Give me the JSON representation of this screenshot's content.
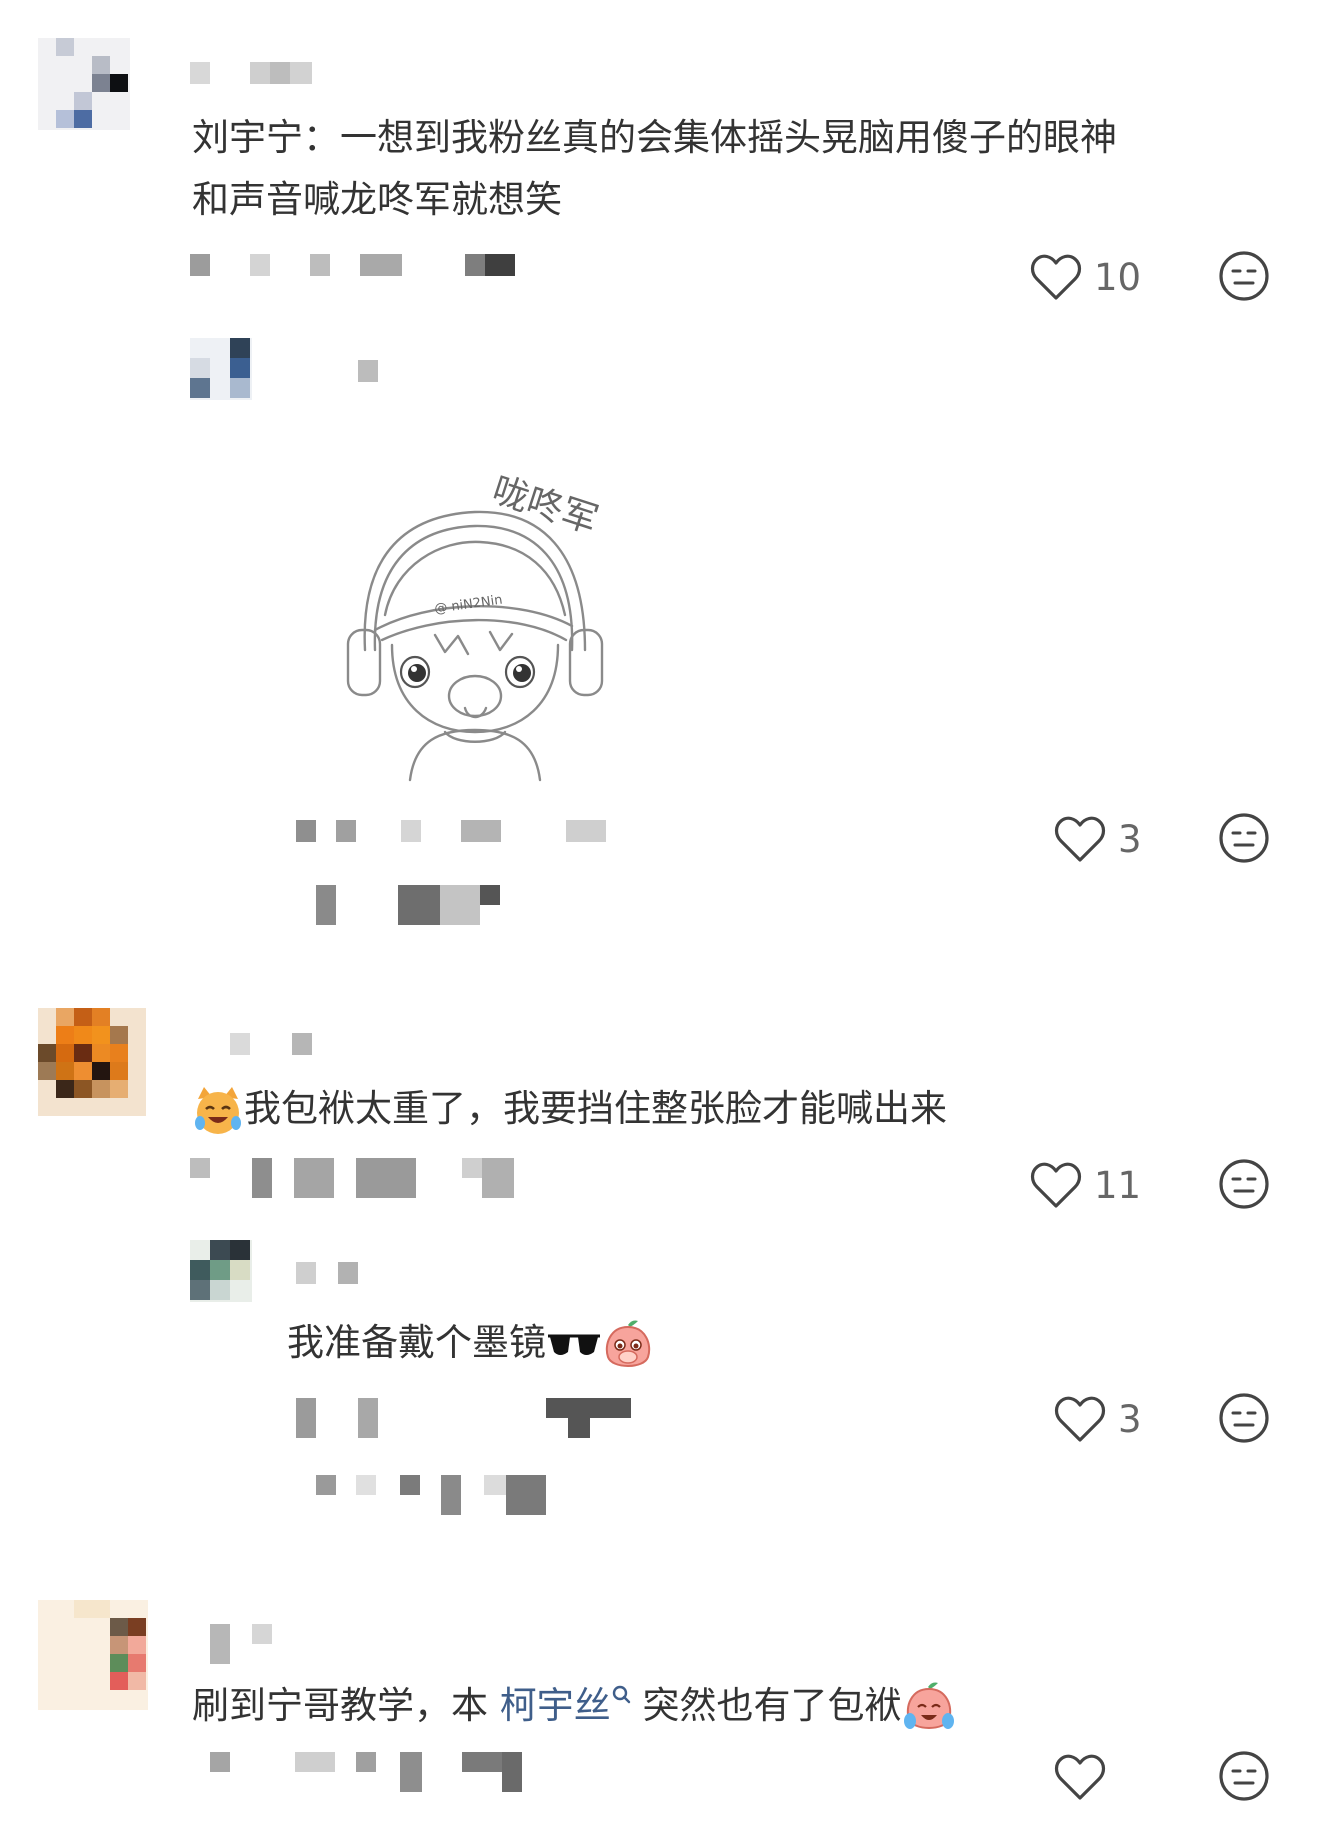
{
  "comments": [
    {
      "text_line1": "刘宇宁：一想到我粉丝真的会集体摇头晃脑用傻子的眼神",
      "text_line2": "和声音喊龙咚军就想笑",
      "likes": "10"
    },
    {
      "reply_image_caption": "咙咚军",
      "reply_image_watermark": "@ niN2Nin",
      "likes": "3"
    },
    {
      "text": "我包袱太重了，我要挡住整张脸才能喊出来",
      "likes": "11"
    },
    {
      "text": "我准备戴个墨镜",
      "likes": "3"
    },
    {
      "text_before_link": "刷到宁哥教学，本 ",
      "link_text": "柯宇丝",
      "text_after_link": " 突然也有了包袱"
    }
  ],
  "icons": {
    "like": "heart-outline-icon",
    "dislike": "neutral-face-icon",
    "search_link": "search-icon"
  },
  "colors": {
    "text": "#333333",
    "count": "#666666",
    "link": "#3f5e8a",
    "icon_stroke": "#444444"
  }
}
